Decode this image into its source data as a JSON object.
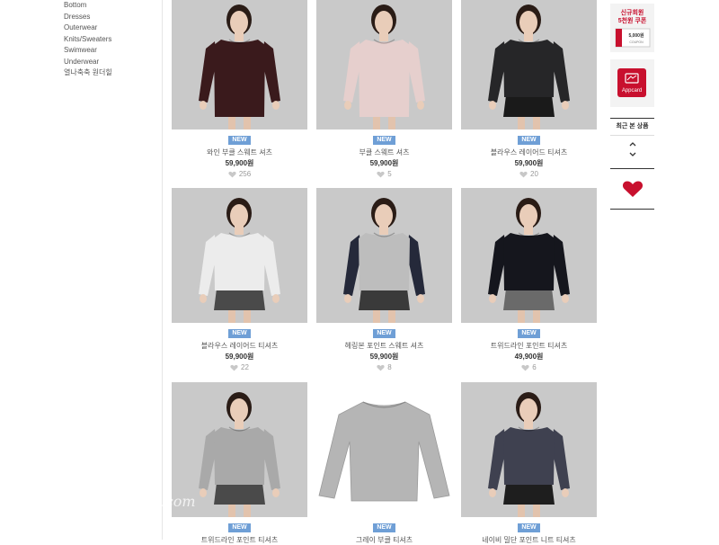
{
  "categories": [
    "Bottom",
    "Dresses",
    "Outerwear",
    "Knits/Sweaters",
    "Swimwear",
    "Underwear",
    "열나축축 원더힐"
  ],
  "products": [
    {
      "badge": "NEW",
      "name": "와인 부클 스웨트 셔츠",
      "price": "59,900원",
      "likes": "256",
      "photo_bg": "#c9c9c9",
      "garment_color": "#3a1a1c",
      "bottom_color": "#3a1a1c",
      "bottom_visible": false
    },
    {
      "badge": "NEW",
      "name": "부클 스웨트 셔츠",
      "price": "59,900원",
      "likes": "5",
      "photo_bg": "#c9c9c9",
      "garment_color": "#e6cfcd",
      "bottom_color": "#e6cfcd",
      "bottom_visible": false
    },
    {
      "badge": "NEW",
      "name": "블라우스 레이어드 티셔츠",
      "price": "59,900원",
      "likes": "20",
      "photo_bg": "#c9c9c9",
      "garment_color": "#262628",
      "bottom_color": "#1a1a1a",
      "bottom_visible": true
    },
    {
      "badge": "NEW",
      "name": "블라우스 레이어드 티셔츠",
      "price": "59,900원",
      "likes": "22",
      "photo_bg": "#c9c9c9",
      "garment_color": "#ececec",
      "bottom_color": "#4a4a4a",
      "bottom_visible": true
    },
    {
      "badge": "NEW",
      "name": "헤링본 포인트 스웨트 셔츠",
      "price": "59,900원",
      "likes": "8",
      "photo_bg": "#c9c9c9",
      "garment_color": "#bdbdbd",
      "sleeve_color": "#25293a",
      "bottom_color": "#3a3a3a",
      "bottom_visible": true
    },
    {
      "badge": "NEW",
      "name": "트위드라인 포인트 티셔츠",
      "price": "49,900원",
      "likes": "6",
      "photo_bg": "#c9c9c9",
      "garment_color": "#15161d",
      "bottom_color": "#6a6a6a",
      "bottom_visible": true
    },
    {
      "badge": "NEW",
      "name": "트위드라인 포인트 티셔츠",
      "price": "",
      "likes": "",
      "photo_bg": "#c9c9c9",
      "garment_color": "#a9a9a9",
      "bottom_color": "#4a4a4a",
      "bottom_visible": true
    },
    {
      "badge": "NEW",
      "name": "그레이 부클 티셔츠",
      "price": "",
      "likes": "",
      "photo_bg": "#ffffff",
      "garment_color": "#b5b5b5",
      "flat": true
    },
    {
      "badge": "NEW",
      "name": "네이비 밀단 포인트 니트 티셔츠",
      "price": "",
      "likes": "",
      "photo_bg": "#c9c9c9",
      "garment_color": "#3f4150",
      "bottom_color": "#1e1e1e",
      "bottom_visible": true
    }
  ],
  "coupon": {
    "line1": "신규회원",
    "line2": "5천원 쿠폰",
    "card_amount": "5,000원",
    "card_label": "COUPON"
  },
  "appcard": {
    "label": "Appcard"
  },
  "recent": {
    "title": "최근 본 상품"
  },
  "watermark": {
    "line1": "a",
    "line2": "ai.com"
  },
  "colors": {
    "accent": "#c8102e",
    "badge": "#6f9fd6"
  }
}
